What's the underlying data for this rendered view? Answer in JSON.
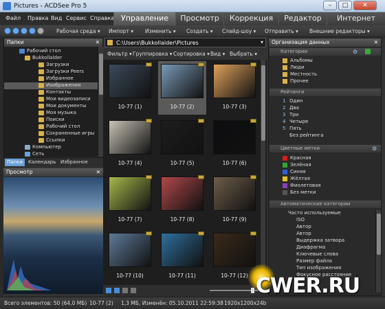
{
  "window": {
    "title": "Pictures - ACDSee Pro 5",
    "min": "–",
    "max": "□",
    "close": "✕"
  },
  "menu": [
    "Файл",
    "Правка",
    "Вид",
    "Сервис",
    "Справка"
  ],
  "modes": [
    "Управление",
    "Просмотр",
    "Коррекция",
    "Редактор",
    "Интернет"
  ],
  "toolbar": {
    "items": [
      "Рабочая среда ▾",
      "Импорт ▾",
      "Изменить ▾",
      "Создать ▾",
      "Слайд-шоу ▾",
      "Отправить ▾",
      "Внешние редакторы ▾"
    ]
  },
  "folders": {
    "title": "Папки",
    "close": "✕",
    "tree": [
      "Рабочий стол",
      "Bukkollaider",
      "Загрузки",
      "Загрузки Peers",
      "Избранное",
      "Изображения",
      "Контакты",
      "Мои видеозаписи",
      "Мои документы",
      "Моя музыка",
      "Поиски",
      "Рабочий стол",
      "Сохраненные игры",
      "Ссылки",
      "Компьютер",
      "Сеть"
    ]
  },
  "lefttabs": [
    "Папки",
    "Календарь",
    "Избранное"
  ],
  "preview": {
    "title": "Просмотр",
    "close": "✕"
  },
  "path": {
    "value": "C:\\Users\\Bukkollaider\\Pictures"
  },
  "filterbar": [
    "Фильтр ▾",
    "Группировка ▾",
    "Сортировка ▾",
    "Вид ▾",
    "Выбрать ▾"
  ],
  "thumbs": [
    "10-77 (1)",
    "10-77 (2)",
    "10-77 (3)",
    "10-77 (4)",
    "10-77 (5)",
    "10-77 (6)",
    "10-77 (7)",
    "10-77 (8)",
    "10-77 (9)",
    "10-77 (10)",
    "10-77 (11)",
    "10-77 (12)"
  ],
  "thumbcolors": [
    "#3b4a5c",
    "#7a9ab8",
    "#e0a15a",
    "#c9c2b6",
    "#1d1d1d",
    "#0d0d10",
    "#a7b84a",
    "#b0484a",
    "#6e5d4a",
    "#5e7a99",
    "#2f6f9c",
    "#3a2a1a"
  ],
  "org": {
    "title": "Организация данных",
    "close": "✕",
    "categories_label": "Категории",
    "categories": [
      "Альбомы",
      "Люди",
      "Местность",
      "Прочее"
    ],
    "ratings_label": "Рейтинги",
    "ratings": [
      "Один",
      "Два",
      "Три",
      "Четыре",
      "Пять",
      "Без рейтинга"
    ],
    "ratings_num": [
      "1",
      "2",
      "3",
      "4",
      "5",
      ""
    ],
    "colors_label": "Цветные метки",
    "colors": [
      "Красная",
      "Зелёная",
      "Синяя",
      "Жёлтая",
      "Фиолетовая",
      "Без метки"
    ],
    "color_hex": [
      "#d81c1c",
      "#2fa82f",
      "#2d5fd0",
      "#e8c21c",
      "#8a3fc0",
      "#555555"
    ],
    "auto_label": "Автоматические категории",
    "auto": [
      "Часто используемые",
      "ISO",
      "Автор",
      "Автор",
      "Выдержка затвора",
      "Диафрагма",
      "Ключевые слова",
      "Размер файла",
      "Тип изображения",
      "Фокусное расстояние"
    ]
  },
  "status": {
    "total": "Всего элементов: 50  (64,0 МБ)",
    "sel": "10-77 (2)",
    "info": "1,3 МБ, Изменён: 05.10.2011 22:59:38",
    "dim": "1920x1200x24b"
  },
  "watermark": "CWER.RU"
}
